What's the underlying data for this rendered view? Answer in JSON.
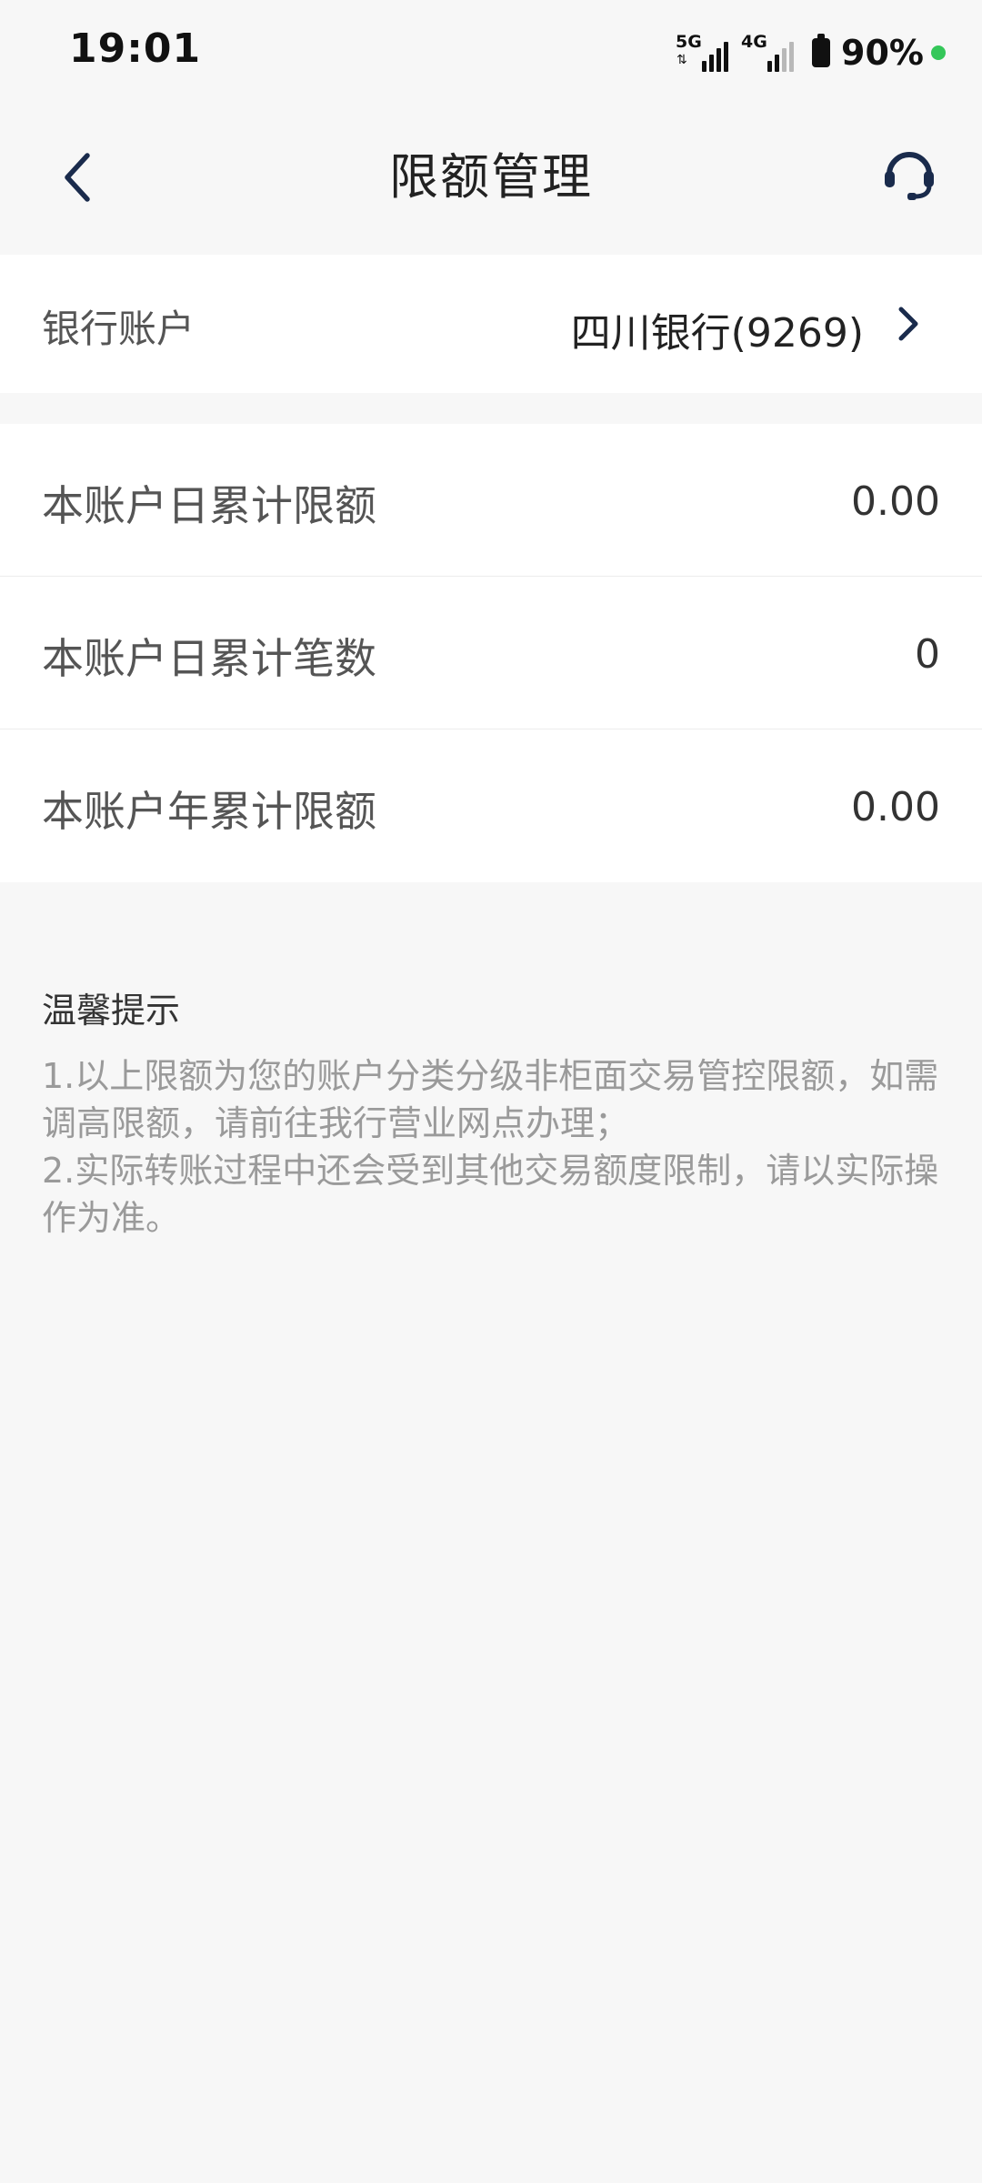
{
  "status_bar": {
    "time": "19:01",
    "network_1": "5G",
    "network_2": "4G",
    "battery": "90%"
  },
  "nav": {
    "title": "限额管理",
    "back_icon": "chevron-left-icon",
    "service_icon": "headset-icon"
  },
  "account": {
    "label": "银行账户",
    "value": "四川银行(9269)"
  },
  "limits": [
    {
      "label": "本账户日累计限额",
      "value": "0.00"
    },
    {
      "label": "本账户日累计笔数",
      "value": "0"
    },
    {
      "label": "本账户年累计限额",
      "value": "0.00"
    }
  ],
  "tips": {
    "title": "温馨提示",
    "lines": [
      "1.以上限额为您的账户分类分级非柜面交易管控限额，如需调高限额，请前往我行营业网点办理；",
      "2.实际转账过程中还会受到其他交易额度限制，请以实际操作为准。"
    ]
  },
  "colors": {
    "accent": "#1a2b4c",
    "background": "#f7f7f7",
    "card": "#ffffff",
    "hint_text": "#9a9a9a"
  }
}
